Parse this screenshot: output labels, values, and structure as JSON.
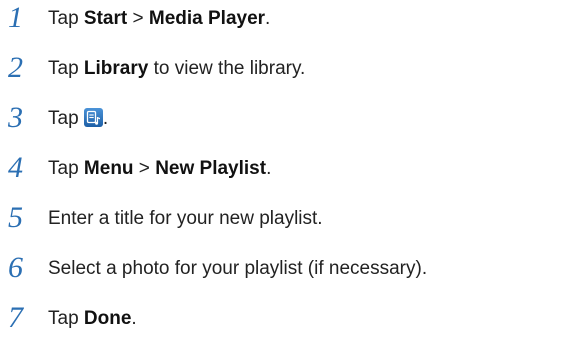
{
  "steps": [
    {
      "number": "1",
      "parts": [
        "Tap ",
        "Start",
        " > ",
        "Media Player",
        "."
      ]
    },
    {
      "number": "2",
      "parts": [
        "Tap ",
        "Library",
        " to view the library."
      ]
    },
    {
      "number": "3",
      "parts": [
        "Tap ",
        "."
      ],
      "icon": "playlist-icon"
    },
    {
      "number": "4",
      "parts": [
        "Tap ",
        "Menu",
        " > ",
        "New Playlist",
        "."
      ]
    },
    {
      "number": "5",
      "text": "Enter a title for your new playlist."
    },
    {
      "number": "6",
      "text": "Select a photo for your playlist (if necessary)."
    },
    {
      "number": "7",
      "parts": [
        "Tap ",
        "Done",
        "."
      ]
    }
  ],
  "colors": {
    "step_number": "#2b6fb3",
    "icon_bg": "#2e78c6"
  }
}
